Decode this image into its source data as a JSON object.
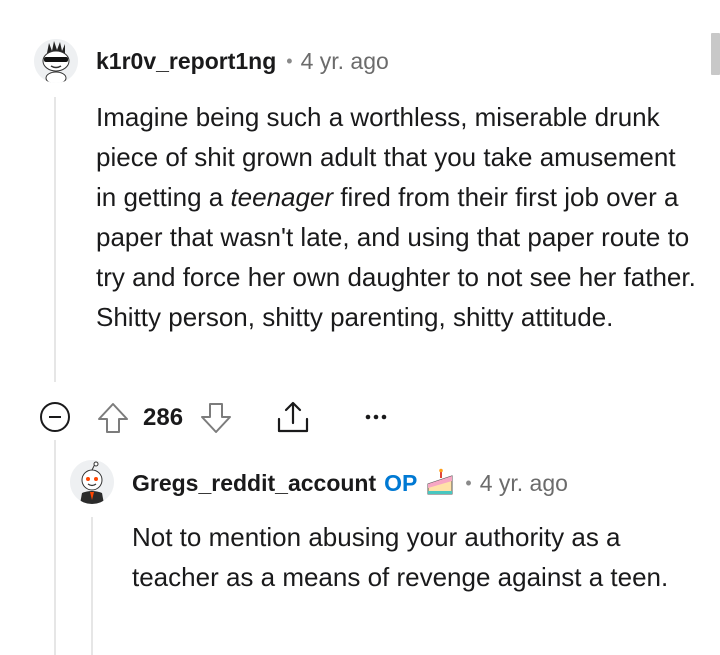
{
  "comment": {
    "username": "k1r0v_report1ng",
    "separator": "•",
    "time": "4 yr. ago",
    "body": {
      "part1": "Imagine being such a worthless, miserable drunk piece of shit grown adult that you take amusement in getting a ",
      "emphasis": "teenager",
      "part2": " fired from their first job over a paper that wasn't late, and using that paper route to try and force her own daughter to not see her father. Shitty person, shitty parenting, shitty attitude."
    },
    "score": "286",
    "icons": {
      "collapse": "collapse-minus-icon",
      "upvote": "upvote-arrow-icon",
      "downvote": "downvote-arrow-icon",
      "share": "share-icon",
      "more": "more-options-icon"
    }
  },
  "reply": {
    "username": "Gregs_reddit_account",
    "op_badge": "OP",
    "flair_icon": "cake-day-icon",
    "separator": "•",
    "time": "4 yr. ago",
    "body": "Not to mention abusing your authority as a teacher as a means of revenge against a teen."
  },
  "colors": {
    "text": "#1a1a1b",
    "meta": "#6b6b6b",
    "op": "#0079d3",
    "thread_line": "#e6e6e6"
  }
}
